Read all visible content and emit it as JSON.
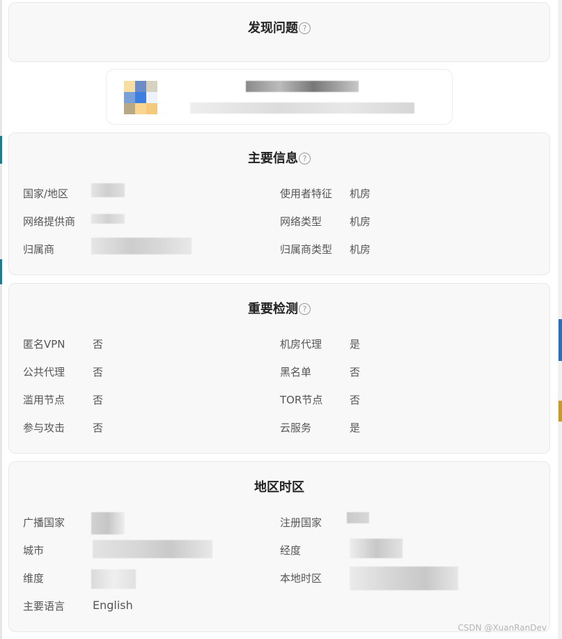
{
  "discover": {
    "title": "发现问题"
  },
  "main_info": {
    "title": "主要信息",
    "left": [
      {
        "label": "国家/地区",
        "value": ""
      },
      {
        "label": "网络提供商",
        "value": ""
      },
      {
        "label": "归属商",
        "value": ""
      }
    ],
    "right": [
      {
        "label": "使用者特征",
        "value": "机房"
      },
      {
        "label": "网络类型",
        "value": "机房"
      },
      {
        "label": "归属商类型",
        "value": "机房"
      }
    ]
  },
  "detection": {
    "title": "重要检测",
    "left": [
      {
        "label": "匿名VPN",
        "value": "否"
      },
      {
        "label": "公共代理",
        "value": "否"
      },
      {
        "label": "滥用节点",
        "value": "否"
      },
      {
        "label": "参与攻击",
        "value": "否"
      }
    ],
    "right": [
      {
        "label": "机房代理",
        "value": "是"
      },
      {
        "label": "黑名单",
        "value": "否"
      },
      {
        "label": "TOR节点",
        "value": "否"
      },
      {
        "label": "云服务",
        "value": "是"
      }
    ]
  },
  "region": {
    "title": "地区时区",
    "left": [
      {
        "label": "广播国家",
        "value": ""
      },
      {
        "label": "城市",
        "value": ""
      },
      {
        "label": "维度",
        "value": ""
      },
      {
        "label": "主要语言",
        "value": "English"
      }
    ],
    "right": [
      {
        "label": "注册国家",
        "value": ""
      },
      {
        "label": "经度",
        "value": ""
      },
      {
        "label": "本地时区",
        "value": ""
      }
    ]
  },
  "icons": {
    "help": "question-circle-icon"
  },
  "colors": {
    "card_bg": "#f8f8f8",
    "title": "#222222",
    "text": "#555555"
  },
  "watermark": "CSDN @XuanRanDev"
}
